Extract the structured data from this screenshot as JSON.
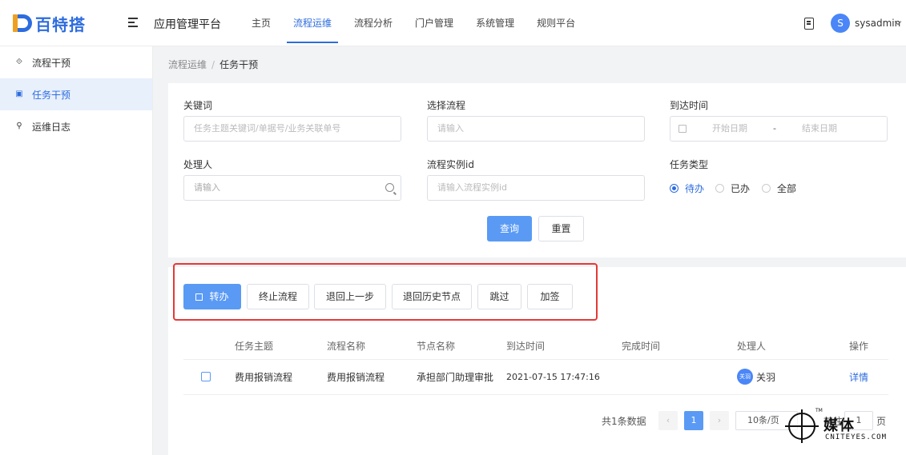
{
  "header": {
    "logo_text": "百特搭",
    "app_title": "应用管理平台",
    "nav": [
      "主页",
      "流程运维",
      "流程分析",
      "门户管理",
      "系统管理",
      "规则平台"
    ],
    "active_nav": "流程运维",
    "avatar_letter": "S",
    "username": "sysadmin"
  },
  "sidebar": {
    "items": [
      {
        "label": "流程干预",
        "icon": "process-icon"
      },
      {
        "label": "任务干预",
        "icon": "task-icon",
        "active": true
      },
      {
        "label": "运维日志",
        "icon": "wrench-icon"
      }
    ]
  },
  "breadcrumb": {
    "parent": "流程运维",
    "current": "任务干预"
  },
  "filters": {
    "keyword": {
      "label": "关键词",
      "placeholder": "任务主题关键词/单据号/业务关联单号"
    },
    "process": {
      "label": "选择流程",
      "placeholder": "请输入"
    },
    "arrival_time": {
      "label": "到达时间",
      "start_placeholder": "开始日期",
      "separator": "-",
      "end_placeholder": "结束日期"
    },
    "handler": {
      "label": "处理人",
      "placeholder": "请输入"
    },
    "instance_id": {
      "label": "流程实例id",
      "placeholder": "请输入流程实例id"
    },
    "task_type": {
      "label": "任务类型",
      "options": [
        "待办",
        "已办",
        "全部"
      ],
      "selected": "待办"
    },
    "search_button": "查询",
    "reset_button": "重置"
  },
  "actions": {
    "transfer": "转办",
    "terminate": "终止流程",
    "back_step": "退回上一步",
    "back_history": "退回历史节点",
    "skip": "跳过",
    "add_sign": "加签"
  },
  "table": {
    "columns": [
      "任务主题",
      "流程名称",
      "节点名称",
      "到达时间",
      "完成时间",
      "处理人",
      "操作"
    ],
    "rows": [
      {
        "subject": "费用报销流程",
        "process_name": "费用报销流程",
        "node_name": "承担部门助理审批",
        "arrival_time": "2021-07-15 17:47:16",
        "completion_time": "",
        "handler_avatar": "关羽",
        "handler": "关羽",
        "action": "详情"
      }
    ]
  },
  "pagination": {
    "total_text": "共1条数据",
    "current_page": "1",
    "page_size": "10条/页",
    "goto_label": "前往",
    "goto_value": "1",
    "page_suffix": "页"
  },
  "watermark": {
    "brand": "媒体",
    "sub": "CNITEYES.COM",
    "tm": "TM"
  },
  "colors": {
    "primary": "#2d6cdf",
    "button_primary": "#5a9af5",
    "highlight": "#e53935"
  }
}
